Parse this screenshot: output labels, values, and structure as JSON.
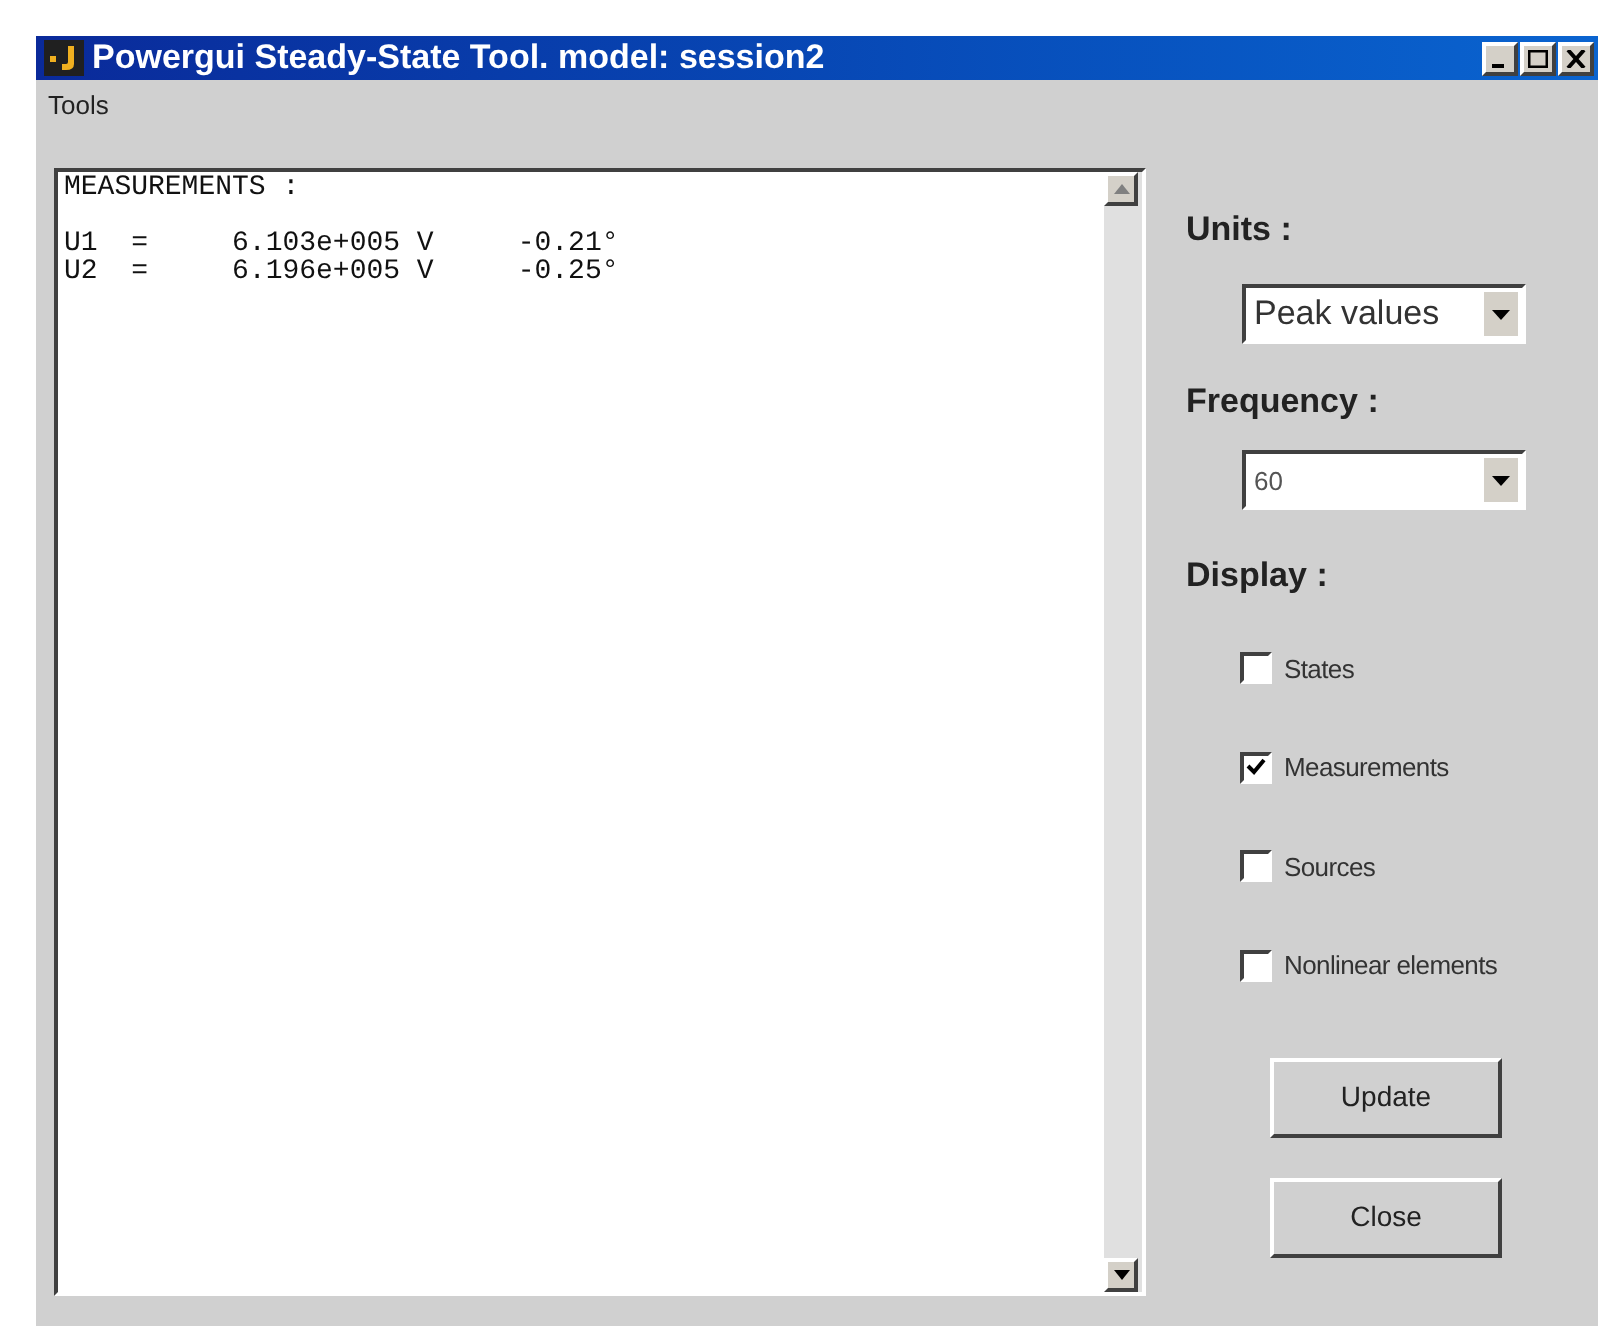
{
  "window": {
    "title": "Powergui Steady-State Tool. model: session2"
  },
  "menu": [
    "Tools"
  ],
  "output": {
    "lines": [
      "MEASUREMENTS :",
      "U1  =     6.103e+005 V     -0.21°",
      "U2  =     6.196e+005 V     -0.25°"
    ]
  },
  "units": {
    "label": "Units :",
    "value": "Peak values"
  },
  "frequency": {
    "label": "Frequency :",
    "value": "60"
  },
  "display": {
    "label": "Display :",
    "options": [
      {
        "label": "States",
        "checked": false
      },
      {
        "label": "Measurements",
        "checked": true
      },
      {
        "label": "Sources",
        "checked": false
      },
      {
        "label": "Nonlinear elements",
        "checked": false
      }
    ]
  },
  "buttons": [
    "Update",
    "Close"
  ]
}
